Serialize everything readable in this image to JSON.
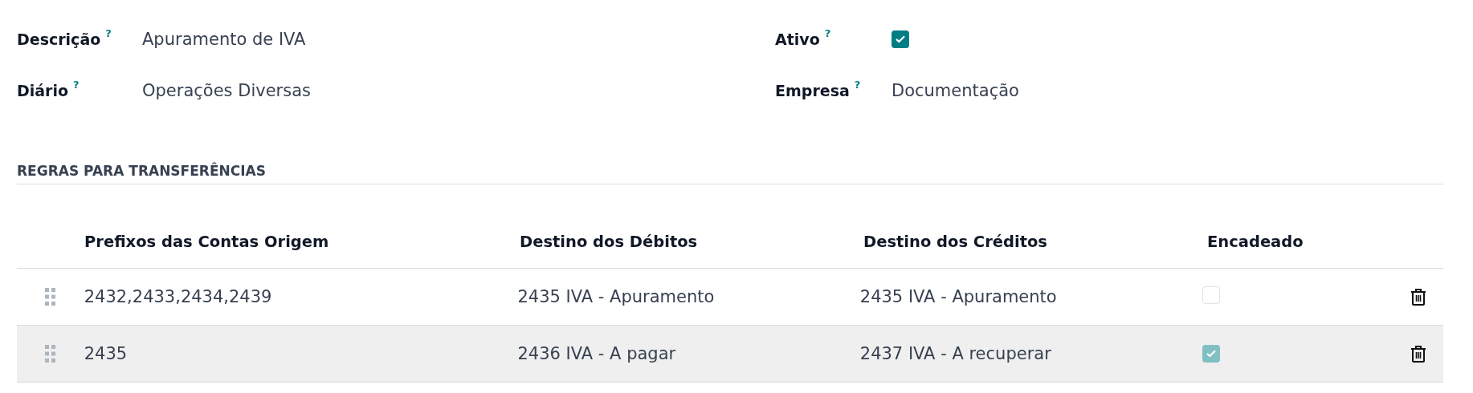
{
  "fields_left": [
    {
      "label": "Descrição",
      "help": "?",
      "value": "Apuramento de IVA"
    },
    {
      "label": "Diário",
      "help": "?",
      "value": "Operações Diversas"
    }
  ],
  "fields_right": [
    {
      "label": "Ativo",
      "help": "?",
      "kind": "checkbox",
      "checked": true
    },
    {
      "label": "Empresa",
      "help": "?",
      "kind": "text",
      "value": "Documentação"
    }
  ],
  "section_title": "REGRAS PARA TRANSFERÊNCIAS",
  "table": {
    "columns": [
      "Prefixos das Contas Origem",
      "Destino dos Débitos",
      "Destino dos Créditos",
      "Encadeado"
    ],
    "rows": [
      {
        "prefixes": "2432,2433,2434,2439",
        "debit": "2435 IVA - Apuramento",
        "credit": "2435 IVA - Apuramento",
        "chained": false,
        "highlighted": false
      },
      {
        "prefixes": "2435",
        "debit": "2436 IVA - A pagar",
        "credit": "2437 IVA - A recuperar",
        "chained": true,
        "highlighted": true
      }
    ]
  }
}
